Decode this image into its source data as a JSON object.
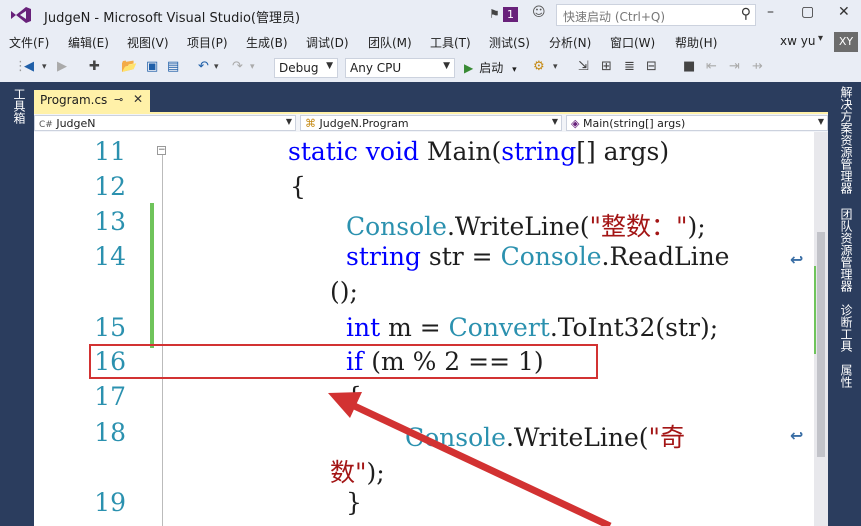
{
  "window": {
    "title": "JudgeN - Microsoft Visual Studio(管理员)",
    "notification_count": "1",
    "quick_launch_placeholder": "快速启动 (Ctrl+Q)"
  },
  "menu": [
    "文件(F)",
    "编辑(E)",
    "视图(V)",
    "项目(P)",
    "生成(B)",
    "调试(D)",
    "团队(M)",
    "工具(T)",
    "测试(S)",
    "分析(N)",
    "窗口(W)",
    "帮助(H)"
  ],
  "user": {
    "name": "xw yu",
    "initials": "XY"
  },
  "toolbar": {
    "config": "Debug",
    "platform": "Any CPU",
    "start_label": "启动"
  },
  "left_rail": {
    "toolbox": "工具箱"
  },
  "right_rail": {
    "solution_explorer": "解决方案资源管理器",
    "team_explorer": "团队资源管理器",
    "diagnostics": "诊断工具",
    "properties": "属性"
  },
  "document_tab": {
    "name": "Program.cs"
  },
  "navbar": {
    "project": "JudgeN",
    "class": "JudgeN.Program",
    "member": "Main(string[] args)"
  },
  "code_lines": [
    {
      "num": "11",
      "tokens": [
        {
          "t": "static",
          "c": "kw"
        },
        {
          "t": " "
        },
        {
          "t": "void",
          "c": "kw"
        },
        {
          "t": " Main("
        },
        {
          "t": "string",
          "c": "kw"
        },
        {
          "t": "[] args)"
        }
      ]
    },
    {
      "num": "12",
      "tokens": [
        {
          "t": "{"
        }
      ]
    },
    {
      "num": "13",
      "tokens": [
        {
          "t": "Console",
          "c": "ty"
        },
        {
          "t": ".WriteLine("
        },
        {
          "t": "\"整数：\"",
          "c": "st"
        },
        {
          "t": ");"
        }
      ]
    },
    {
      "num": "14",
      "tokens": [
        {
          "t": "string",
          "c": "kw"
        },
        {
          "t": " str = "
        },
        {
          "t": "Console",
          "c": "ty"
        },
        {
          "t": ".ReadLine"
        }
      ]
    },
    {
      "num": "",
      "tokens": [
        {
          "t": "();"
        }
      ]
    },
    {
      "num": "15",
      "tokens": [
        {
          "t": "int",
          "c": "kw"
        },
        {
          "t": " m = "
        },
        {
          "t": "Convert",
          "c": "ty"
        },
        {
          "t": ".ToInt32(str);"
        }
      ]
    },
    {
      "num": "16",
      "tokens": [
        {
          "t": "if",
          "c": "kw"
        },
        {
          "t": " (m % 2 == 1)"
        }
      ]
    },
    {
      "num": "17",
      "tokens": [
        {
          "t": "{"
        }
      ]
    },
    {
      "num": "18",
      "tokens": [
        {
          "t": "Console",
          "c": "ty"
        },
        {
          "t": ".WriteLine("
        },
        {
          "t": "\"奇",
          "c": "st"
        }
      ]
    },
    {
      "num": "",
      "tokens": [
        {
          "t": "数\"",
          "c": "st"
        },
        {
          "t": ");"
        }
      ]
    },
    {
      "num": "19",
      "tokens": [
        {
          "t": "}"
        }
      ]
    }
  ],
  "colors": {
    "chrome": "#e9edf5",
    "accent_purple": "#68217a",
    "keyword": "#0000ff",
    "type": "#2b91af",
    "string": "#a31515",
    "annotation": "#d23232",
    "change_bar": "#6fc45b"
  }
}
